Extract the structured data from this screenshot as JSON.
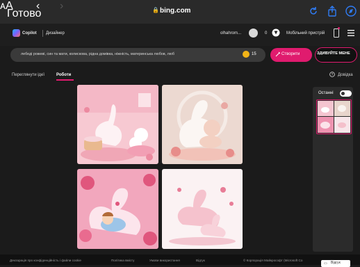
{
  "browser": {
    "done_label": "Готово",
    "back_icon": "chevron-left-icon",
    "forward_icon": "chevron-right-icon",
    "text_size_label": "ᴀA",
    "url": "bing.com",
    "lock_icon": "lock-icon",
    "reload_icon": "reload-icon",
    "share_icon": "share-icon",
    "compass_icon": "compass-icon"
  },
  "header": {
    "brand": "Copilot",
    "section": "Дизайнер",
    "user": "olhahrom...",
    "coins": "0",
    "device_label": "Мобільний пристрій",
    "menu_icon": "hamburger-menu-icon"
  },
  "prompt": {
    "text": "лебеді рожеві, син та мати, колискова, рідна домівка, ніжність, материнська любов, люб",
    "boosts": "15",
    "create_label": "Створити",
    "surprise_label": "ЗДИВУЙТЕ МЕНЕ"
  },
  "tabs": {
    "explore": "Переглянути ідеї",
    "creations": "Роботи",
    "help": "Довідка"
  },
  "recent": {
    "title": "Останні"
  },
  "footer": {
    "privacy": "Декларація про конфіденційність і файли cookie",
    "content_policy": "Політика вмісту",
    "terms": "Умови використання",
    "feedback_link": "Відгук",
    "copyright": "© Корпорація Майкрософт (Microsoft Co",
    "feedback_button": "Відгук"
  },
  "colors": {
    "accent": "#e01b6e",
    "browser_blue": "#2f7cf6",
    "background": "#1b1b1b"
  }
}
